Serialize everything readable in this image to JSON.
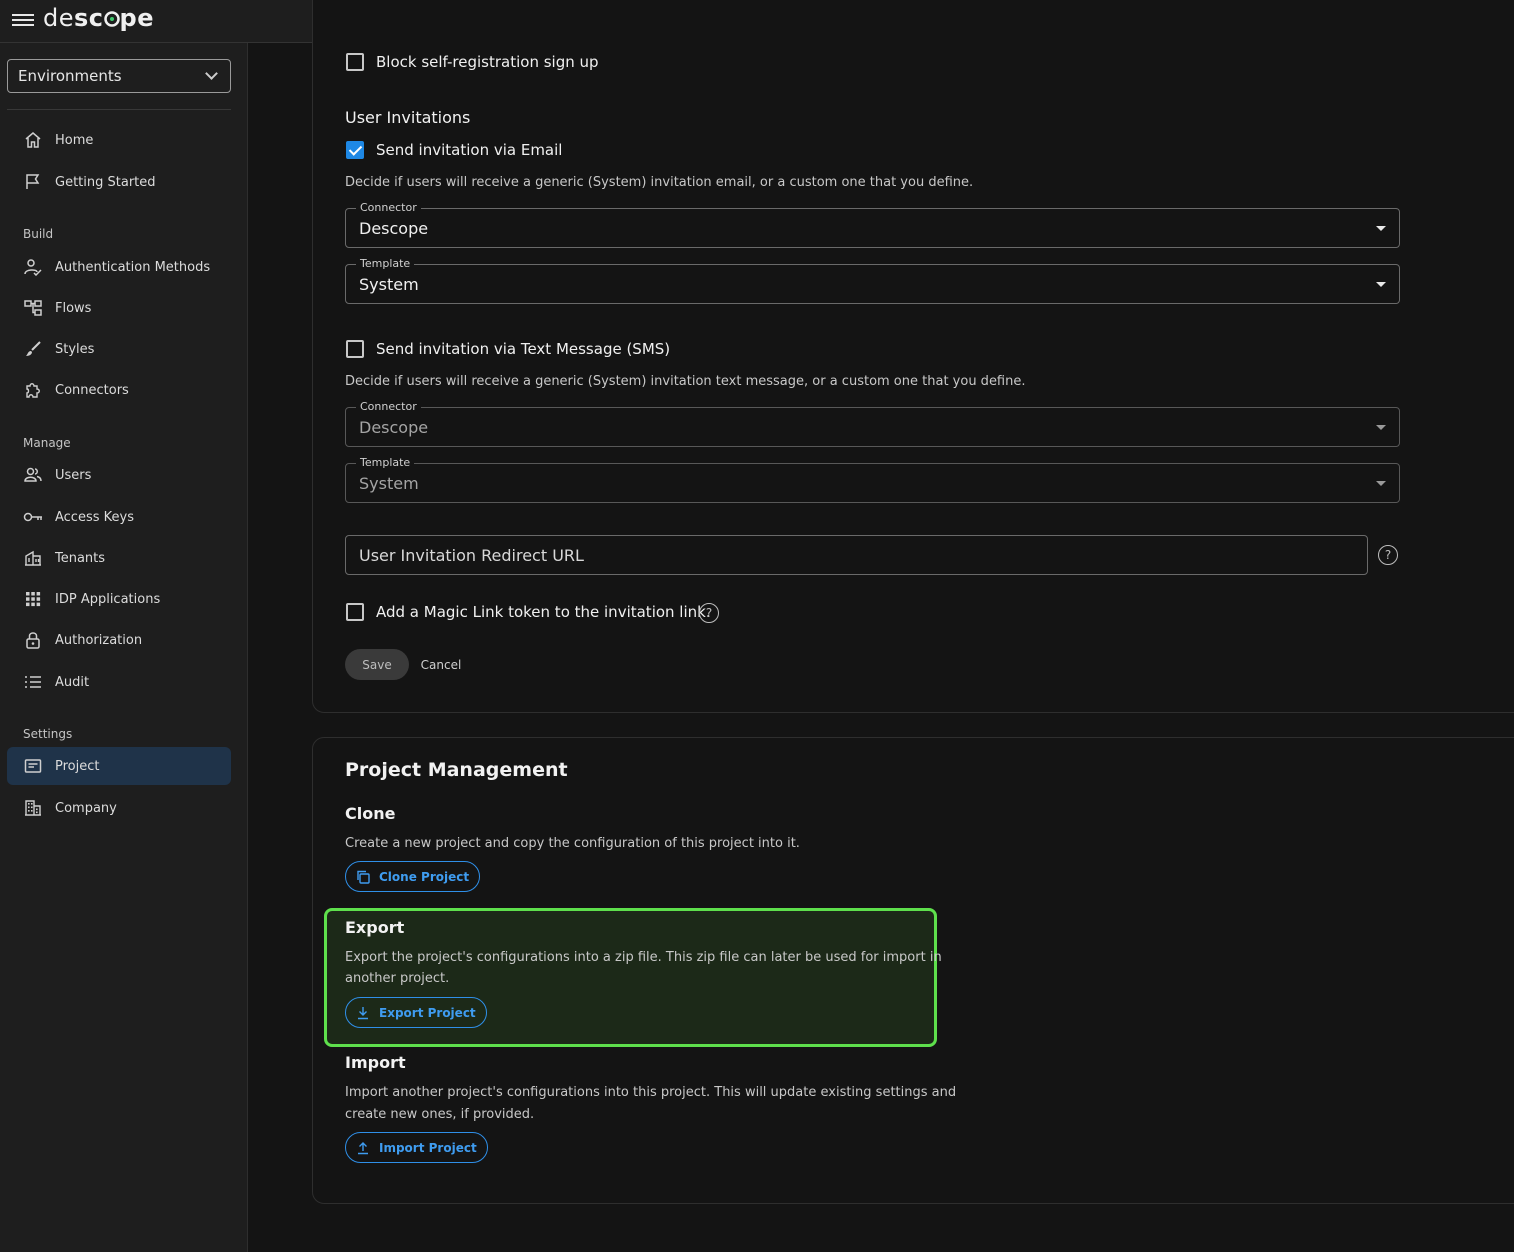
{
  "header": {
    "logo_left": "desc",
    "logo_mid": "o",
    "logo_right": "pe",
    "logo_pre": "de"
  },
  "sidebar": {
    "environment": "Environments",
    "items": [
      {
        "label": "Home",
        "icon": "home-icon"
      },
      {
        "label": "Getting Started",
        "icon": "flag-icon"
      },
      {
        "label": "Authentication Methods",
        "icon": "user-check-icon"
      },
      {
        "label": "Flows",
        "icon": "flows-icon"
      },
      {
        "label": "Styles",
        "icon": "brush-icon"
      },
      {
        "label": "Connectors",
        "icon": "puzzle-icon"
      },
      {
        "label": "Users",
        "icon": "users-icon"
      },
      {
        "label": "Access Keys",
        "icon": "key-icon"
      },
      {
        "label": "Tenants",
        "icon": "tenants-icon"
      },
      {
        "label": "IDP Applications",
        "icon": "grid-icon"
      },
      {
        "label": "Authorization",
        "icon": "lock-icon"
      },
      {
        "label": "Audit",
        "icon": "list-icon"
      },
      {
        "label": "Project",
        "icon": "project-icon"
      },
      {
        "label": "Company",
        "icon": "building-icon"
      }
    ],
    "sections": {
      "build": "Build",
      "manage": "Manage",
      "settings": "Settings"
    },
    "active": "Project"
  },
  "settings": {
    "block_self_registration": {
      "label": "Block self-registration sign up",
      "checked": false
    },
    "invitations_title": "User Invitations",
    "email": {
      "label": "Send invitation via Email",
      "checked": true,
      "description": "Decide if users will receive a generic (System) invitation email, or a custom one that you define.",
      "connector_label": "Connector",
      "connector_value": "Descope",
      "template_label": "Template",
      "template_value": "System"
    },
    "sms": {
      "label": "Send invitation via Text Message (SMS)",
      "checked": false,
      "description": "Decide if users will receive a generic (System) invitation text message, or a custom one that you define.",
      "connector_label": "Connector",
      "connector_value": "Descope",
      "template_label": "Template",
      "template_value": "System"
    },
    "redirect_url_placeholder": "User Invitation Redirect URL",
    "magic_link": {
      "label": "Add a Magic Link token to the invitation link.",
      "checked": false
    },
    "save_label": "Save",
    "cancel_label": "Cancel"
  },
  "project_management": {
    "title": "Project Management",
    "clone": {
      "title": "Clone",
      "description": "Create a new project and copy the configuration of this project into it.",
      "button": "Clone Project"
    },
    "export": {
      "title": "Export",
      "description_line1": "Export the project's configurations into a zip file. This zip file can later be used for import in",
      "description_line2": "another project.",
      "button": "Export Project"
    },
    "import": {
      "title": "Import",
      "description_line1": "Import another project's configurations into this project. This will update existing settings and",
      "description_line2": "create new ones, if provided.",
      "button": "Import Project"
    }
  },
  "colors": {
    "accent": "#1e88e5",
    "highlight": "#5ee04c",
    "active_nav": "#1f3349"
  }
}
